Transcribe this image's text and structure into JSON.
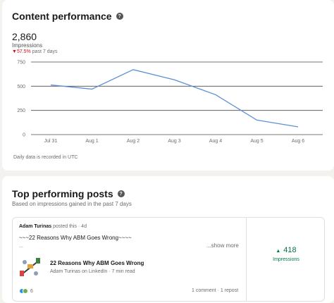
{
  "performance": {
    "title": "Content performance",
    "impressions_value": "2,860",
    "impressions_label": "Impressions",
    "change_pct": "57.5%",
    "change_period": "past 7 days",
    "footnote": "Daily data is recorded in UTC"
  },
  "chart_data": {
    "type": "line",
    "categories": [
      "Jul 31",
      "Aug 1",
      "Aug 2",
      "Aug 3",
      "Aug 4",
      "Aug 5",
      "Aug 6"
    ],
    "series": [
      {
        "values": [
          513,
          470,
          671,
          566,
          412,
          150,
          80
        ]
      }
    ],
    "ylim": [
      0,
      750
    ],
    "yticks": [
      0,
      250,
      500,
      750
    ],
    "grid": true,
    "line_color": "#5b8fd8"
  },
  "top_posts": {
    "title": "Top performing posts",
    "subtitle": "Based on impressions gained in the past 7 days",
    "post": {
      "author": "Adam Turinas",
      "author_suffix": "posted this · 4d",
      "text": "~~~22 Reasons Why ABM Goes Wrong~~~~",
      "ellipsis": "...",
      "show_more": "...show more",
      "article_title": "22 Reasons Why ABM Goes Wrong",
      "article_meta": "Adam Turinas on LinkedIn · 7 min read",
      "reaction_count": "6",
      "comments": "1 comment · 1 repost",
      "impressions_value": "418",
      "impressions_label": "Impressions"
    }
  },
  "colors": {
    "up": "#057642",
    "down": "#cc1016"
  }
}
